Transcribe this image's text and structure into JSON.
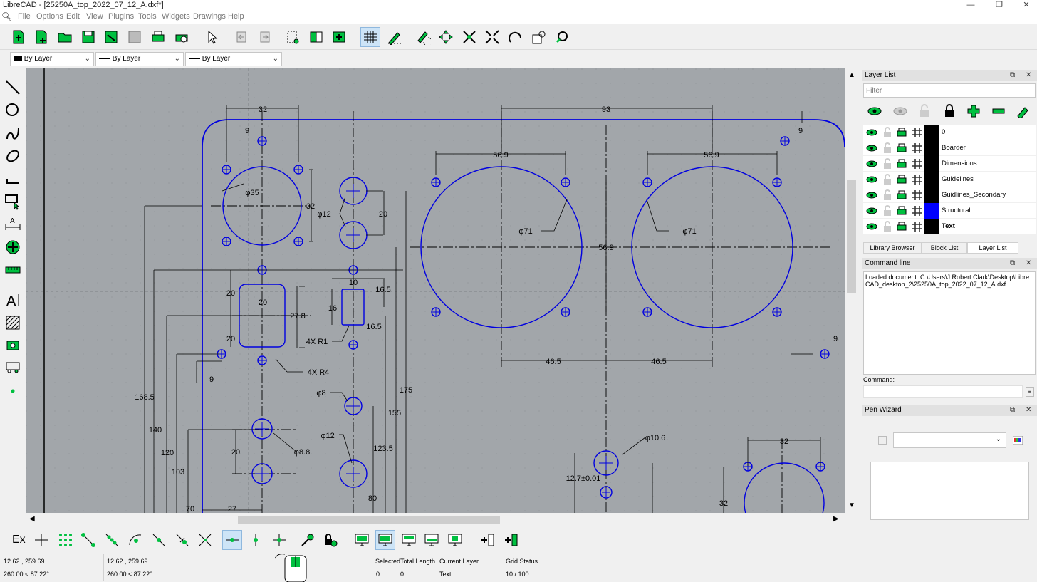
{
  "window": {
    "title": "LibreCAD - [25250A_top_2022_07_12_A.dxf*]",
    "controls": [
      "—",
      "❐",
      "✕"
    ]
  },
  "menu": [
    "File",
    "Options",
    "Edit",
    "View",
    "Plugins",
    "Tools",
    "Widgets",
    "Drawings",
    "Help"
  ],
  "pen_toolbar": {
    "color": "By Layer",
    "width": "By Layer",
    "linetype": "By Layer"
  },
  "colors": {
    "canvas_bg": "#a2a6aa",
    "entity_blue": "#0000e0",
    "dim_black": "#000000",
    "icon_green": "#00c040",
    "selected_btn": "#cde4f7"
  },
  "drawing_dims": {
    "d32a": "32",
    "d9a": "9",
    "d93": "93",
    "d9b": "9",
    "d569a": "56.9",
    "d569b": "56.9",
    "phi35": "φ35",
    "d32b": "32",
    "phi12a": "φ12",
    "d20a": "20",
    "phi71a": "φ71",
    "phi71b": "φ71",
    "d569c": "56.9",
    "d10": "10",
    "d165a": "16.5",
    "d20b": "20",
    "d20c": "20",
    "d278": "27.8",
    "d16": "16",
    "d20d": "20",
    "r1": "4X  R1",
    "d165b": "16.5",
    "r4": "4X  R4",
    "d465a": "46.5",
    "d465b": "46.5",
    "d9c": "9",
    "d9d": "9",
    "d1685": "168.5",
    "phi8": "φ8",
    "d175": "175",
    "d155": "155",
    "d140": "140",
    "d120": "120",
    "d103": "103",
    "phi12b": "φ12",
    "d1235": "123.5",
    "d20e": "20",
    "phi88": "φ8.8",
    "phi106": "φ10.6",
    "d127": "12.7±0.01",
    "d32c": "32",
    "d32d": "32",
    "d80": "80",
    "d70": "70",
    "d27": "27"
  },
  "layer_list": {
    "title": "Layer List",
    "filter_placeholder": "Filter",
    "layers": [
      {
        "name": "0",
        "color": "#000000",
        "bold": false
      },
      {
        "name": "Boarder",
        "color": "#000000",
        "bold": false
      },
      {
        "name": "Dimensions",
        "color": "#000000",
        "bold": false
      },
      {
        "name": "Guidelines",
        "color": "#000000",
        "bold": false
      },
      {
        "name": "Guidlines_Secondary",
        "color": "#000000",
        "bold": false
      },
      {
        "name": "Structural",
        "color": "#0000ff",
        "bold": false
      },
      {
        "name": "Text",
        "color": "#000000",
        "bold": true
      }
    ],
    "tabs": [
      "Library Browser",
      "Block List",
      "Layer List"
    ],
    "active_tab": "Layer List"
  },
  "command_line": {
    "title": "Command line",
    "output": "Loaded document: C:\\Users\\J Robert Clark\\Desktop\\LibreCAD_desktop_2\\25250A_top_2022_07_12_A.dxf",
    "label": "Command:"
  },
  "pen_wizard": {
    "title": "Pen Wizard"
  },
  "snap_toolbar": {
    "ex": "Ex"
  },
  "status": {
    "coord_abs": "12.62 , 259.69",
    "coord_polar": "260.00 < 87.22°",
    "coord_rel": "12.62 , 259.69",
    "coord_rel_polar": "260.00 < 87.22°",
    "selected_label": "Selected",
    "selected_value": "0",
    "total_length_label": "Total Length",
    "total_length_value": "0",
    "current_layer_label": "Current Layer",
    "current_layer_value": "Text",
    "grid_status_label": "Grid Status",
    "grid_status_value": "10 / 100"
  }
}
